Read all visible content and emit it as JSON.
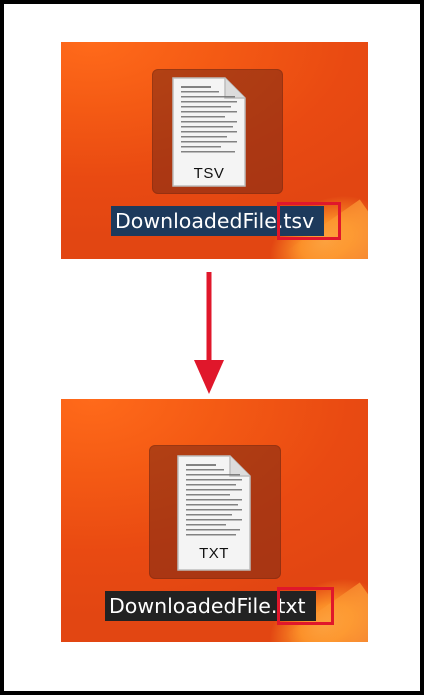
{
  "before": {
    "icon_badge": "TSV",
    "filename_base": "DownloadedFile",
    "filename_ext": ".tsv"
  },
  "after": {
    "icon_badge": "TXT",
    "filename_base": "DownloadedFile",
    "filename_ext": ".txt"
  },
  "colors": {
    "arrow": "#e0172b",
    "highlight_box": "#e0172b",
    "desktop_orange": "#f45a14",
    "selection_blue": "#1d3a5c"
  },
  "icons": {
    "file": "document-icon",
    "arrow": "arrow-down-icon"
  }
}
